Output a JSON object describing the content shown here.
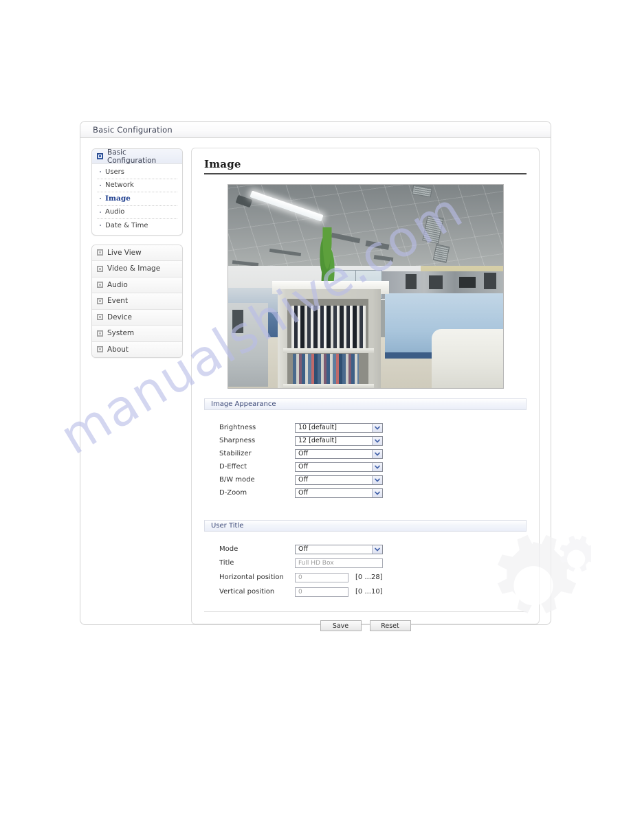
{
  "window": {
    "title": "Basic Configuration"
  },
  "sidebar": {
    "basic_config": {
      "label": "Basic Configuration",
      "icon": "checkbox-icon",
      "items": [
        {
          "label": "Users",
          "active": false
        },
        {
          "label": "Network",
          "active": false
        },
        {
          "label": "Image",
          "active": true
        },
        {
          "label": "Audio",
          "active": false
        },
        {
          "label": "Date & Time",
          "active": false
        }
      ]
    },
    "menu": [
      {
        "label": "Live View",
        "icon": "expand-box-icon"
      },
      {
        "label": "Video & Image",
        "icon": "expand-box-icon"
      },
      {
        "label": "Audio",
        "icon": "expand-box-icon"
      },
      {
        "label": "Event",
        "icon": "expand-box-icon"
      },
      {
        "label": "Device",
        "icon": "expand-box-icon"
      },
      {
        "label": "System",
        "icon": "expand-box-icon"
      },
      {
        "label": "About",
        "icon": "expand-box-icon"
      }
    ]
  },
  "content": {
    "page_title": "Image",
    "preview_alt": "Live camera preview of an office interior with suspended ceiling, fluorescent light, green plant, cubicle partitions and a bookshelf with binders",
    "image_appearance": {
      "section_label": "Image Appearance",
      "fields": [
        {
          "label": "Brightness",
          "value": "10 [default]",
          "type": "select"
        },
        {
          "label": "Sharpness",
          "value": "12 [default]",
          "type": "select"
        },
        {
          "label": "Stabilizer",
          "value": "Off",
          "type": "select"
        },
        {
          "label": "D-Effect",
          "value": "Off",
          "type": "select"
        },
        {
          "label": "B/W mode",
          "value": "Off",
          "type": "select"
        },
        {
          "label": "D-Zoom",
          "value": "Off",
          "type": "select"
        }
      ]
    },
    "user_title": {
      "section_label": "User Title",
      "mode": {
        "label": "Mode",
        "value": "Off"
      },
      "title": {
        "label": "Title",
        "placeholder": "Full HD Box",
        "value": ""
      },
      "horizontal_position": {
        "label": "Horizontal position",
        "placeholder": "0",
        "value": "",
        "range": "[0 ...28]"
      },
      "vertical_position": {
        "label": "Vertical position",
        "placeholder": "0",
        "value": "",
        "range": "[0 ...10]"
      }
    },
    "buttons": {
      "save": "Save",
      "reset": "Reset"
    }
  },
  "watermark": {
    "text": "manualshive.com",
    "color": "#b9bde8",
    "gear_icon": "gear-icon"
  },
  "colors": {
    "accent": "#1f3f8f",
    "section_header_text": "#3d4a78",
    "title_text": "#3f4456"
  }
}
